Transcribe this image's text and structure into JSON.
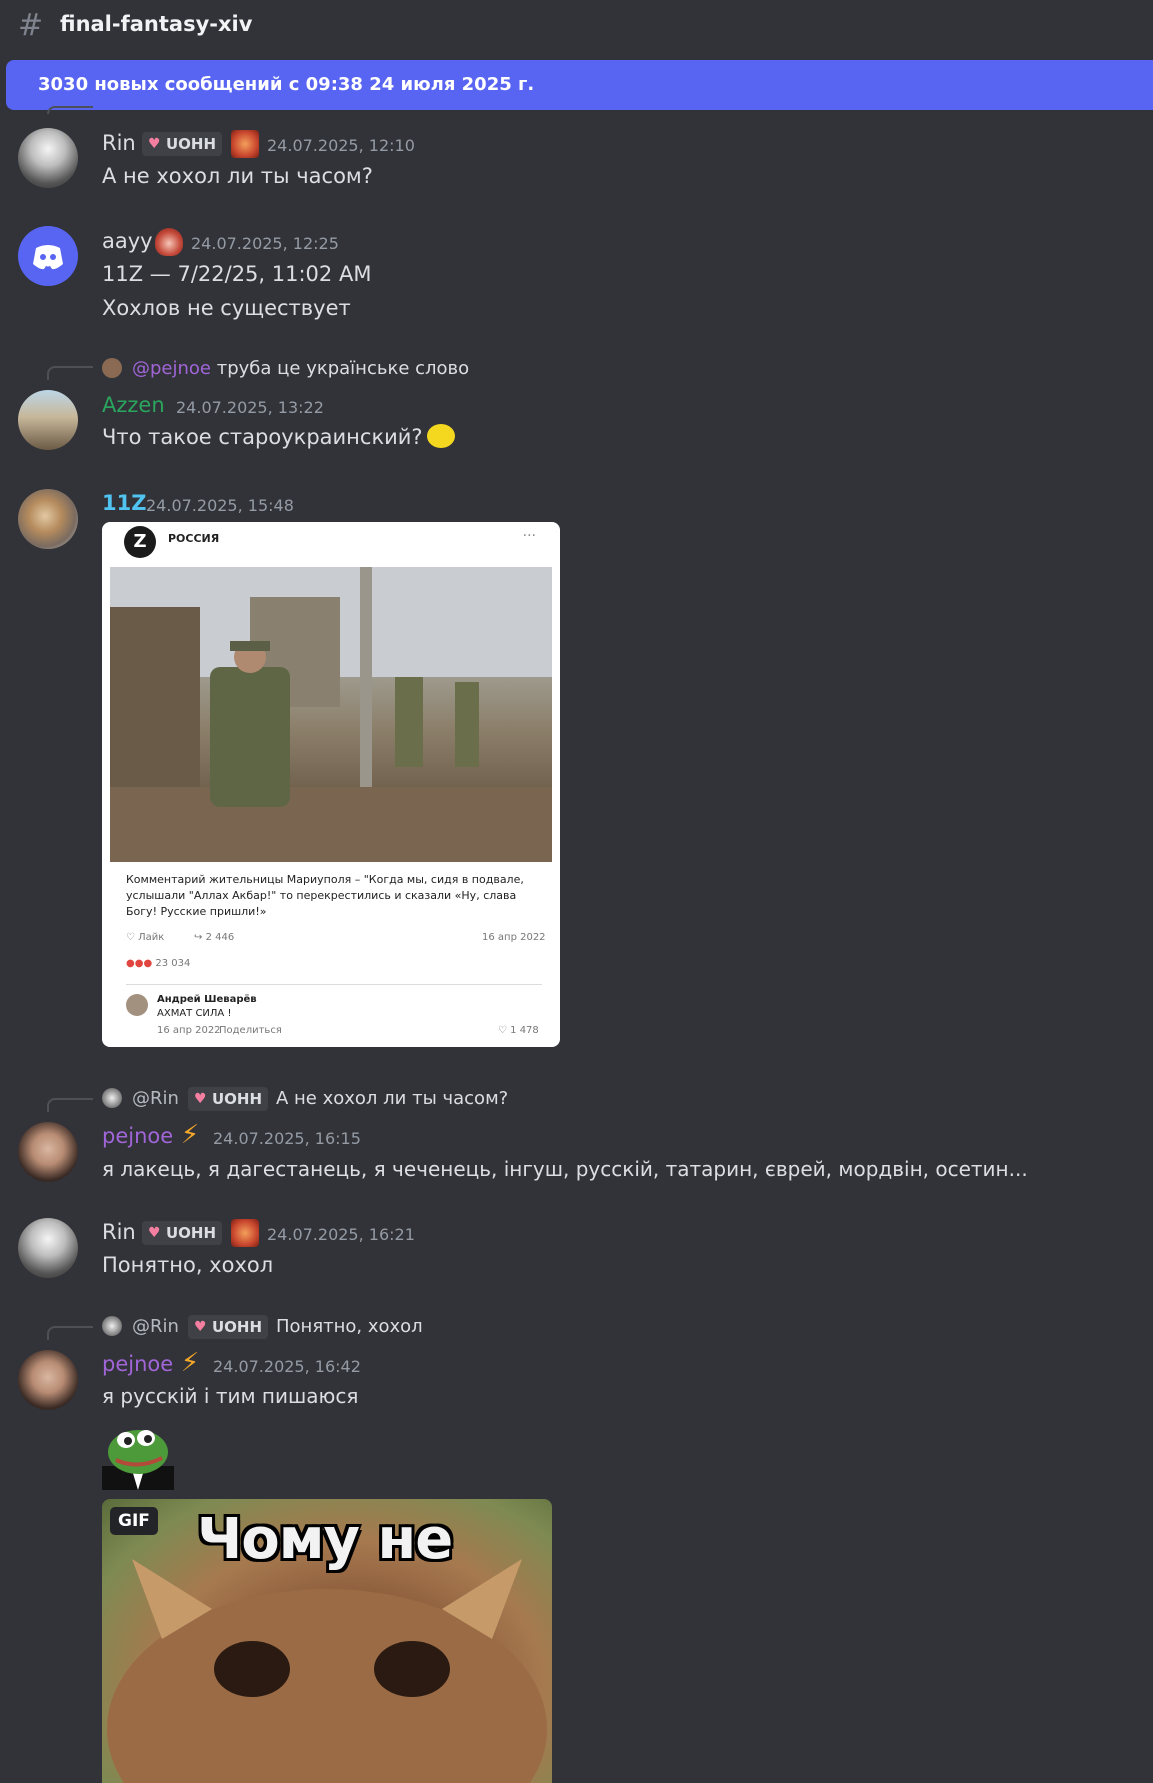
{
  "channel": {
    "name": "final-fantasy-xiv"
  },
  "banner": {
    "text": "3030 новых сообщений с 09:38 24 июля 2025 г."
  },
  "cut_reply": {
    "user": "pejnoe",
    "text": "труба це українське слово"
  },
  "messages": [
    {
      "user": "Rin",
      "tag": "UOHH",
      "time": "24.07.2025, 12:10",
      "text": "А не хохол ли ты часом?"
    },
    {
      "user": "aayy",
      "time": "24.07.2025, 12:25",
      "lines": [
        "11Z — 7/22/25, 11:02 AM",
        "Хохлов не существует"
      ]
    },
    {
      "reply": {
        "mention": "@pejnoe",
        "text": "труба це українське слово"
      },
      "user": "Azzen",
      "time": "24.07.2025, 13:22",
      "text": "Что такое староукраинский?"
    },
    {
      "user": "11Z",
      "time": "24.07.2025, 15:48",
      "embed": {
        "logo": "Z",
        "group": "РОССИЯ",
        "menu": "···",
        "post_text": "Комментарий жительницы Мариуполя – \"Когда мы, сидя в подвале, услышали \"Аллах Акбар!\" то перекрестились и сказали «Ну, слава Богу! Русские пришли!»",
        "like_label": "♡ Лайк",
        "shares": "2 446",
        "date": "16 апр 2022",
        "reactions": "23 034",
        "comment_author": "Андрей Шеварёв",
        "comment_text": "АХМАТ СИЛА !",
        "comment_date": "16 апр 2022",
        "comment_share": "Поделиться",
        "comment_likes": "1 478"
      }
    },
    {
      "reply": {
        "mention": "@Rin",
        "tag": "UOHH",
        "text": "А не хохол ли ты часом?"
      },
      "user": "pejnoe",
      "time": "24.07.2025, 16:15",
      "text": "я лакець, я дагестанець, я чеченець, інгуш, русскій, татарин, єврей, мордвін, осетин..."
    },
    {
      "user": "Rin",
      "tag": "UOHH",
      "time": "24.07.2025, 16:21",
      "text": "Понятно, хохол"
    },
    {
      "reply": {
        "mention": "@Rin",
        "tag": "UOHH",
        "text": "Понятно, хохол"
      },
      "user": "pejnoe",
      "time": "24.07.2025, 16:42",
      "text": "я русскій і тим пишаюся",
      "gif": {
        "badge": "GIF",
        "caption": "Чому не"
      }
    }
  ],
  "colors": {
    "accent": "#5865f2",
    "background": "#323339",
    "pejnoe": "#a165d8",
    "azzen": "#2aa55d",
    "z11": "#50c3f0"
  }
}
